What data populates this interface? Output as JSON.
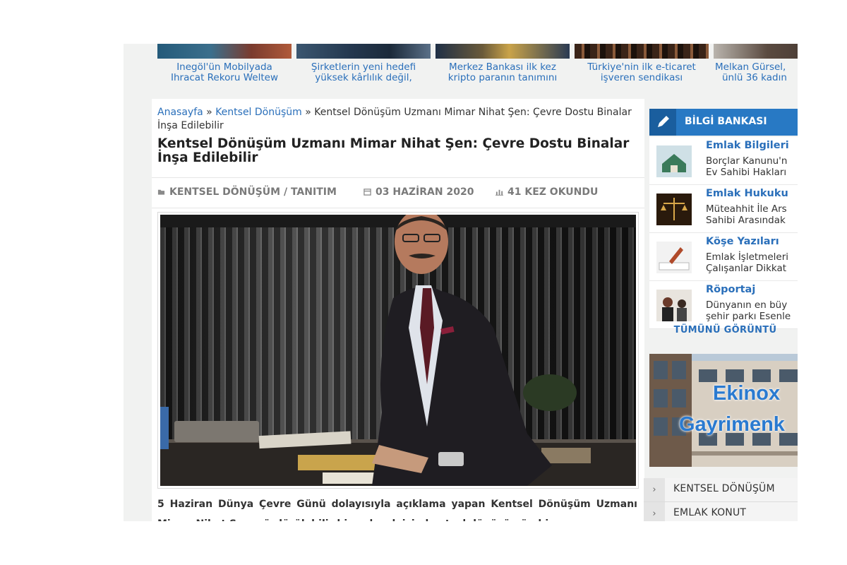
{
  "news_strip": [
    {
      "title_line1": "İnegöl'ün Mobilyada",
      "title_line2": "İhracat Rekoru Weltew"
    },
    {
      "title_line1": "Şirketlerin yeni hedefi",
      "title_line2": "yüksek kârlılık değil,"
    },
    {
      "title_line1": "Merkez Bankası ilk kez",
      "title_line2": "kripto paranın tanımını"
    },
    {
      "title_line1": "Türkiye'nin ilk e-ticaret",
      "title_line2": "işveren sendikası"
    },
    {
      "title_line1": "Melkan Gürsel,",
      "title_line2": "ünlü 36 kadın"
    }
  ],
  "breadcrumb": {
    "home": "Anasayfa",
    "separator": "»",
    "category": "Kentsel Dönüşüm",
    "current": "Kentsel Dönüşüm Uzmanı Mimar Nihat Şen: Çevre Dostu Binalar İnşa Edilebilir"
  },
  "article": {
    "title": "Kentsel Dönüşüm Uzmanı Mimar Nihat Şen: Çevre Dostu Binalar İnşa Edilebilir",
    "category": "KENTSEL DÖNÜŞÜM / TANITIM",
    "date": "03 HAZİRAN 2020",
    "views": "41 KEZ OKUNDU",
    "lead": "5 Haziran Dünya Çevre Günü dolayısıyla açıklama yapan Kentsel Dönüşüm Uzmanı Mimar Nihat Şen, sürdürülebilir bir gelecek için kentsel dönüşümün bir"
  },
  "sidebar": {
    "header": "BİLGİ BANKASI",
    "items": [
      {
        "title": "Emlak Bilgileri",
        "line1": "Borçlar Kanunu'n",
        "line2": "Ev Sahibi Hakları"
      },
      {
        "title": "Emlak Hukuku",
        "line1": "Müteahhit İle Ars",
        "line2": "Sahibi Arasındak"
      },
      {
        "title": "Köşe Yazıları",
        "line1": "Emlak İşletmeleri",
        "line2": "Çalışanlar Dikkat"
      },
      {
        "title": "Röportaj",
        "line1": "Dünyanın en büy",
        "line2": "şehir parkı Esenle"
      }
    ],
    "view_all": "TÜMÜNÜ GÖRÜNTÜ",
    "ad": {
      "line1": "Ekinox",
      "line2": "Gayrimenk"
    },
    "categories": [
      "KENTSEL DÖNÜŞÜM",
      "EMLAK KONUT"
    ]
  },
  "colors": {
    "link": "#2a6fba",
    "header_blue": "#2879c4",
    "header_dark": "#1a5e9e"
  }
}
